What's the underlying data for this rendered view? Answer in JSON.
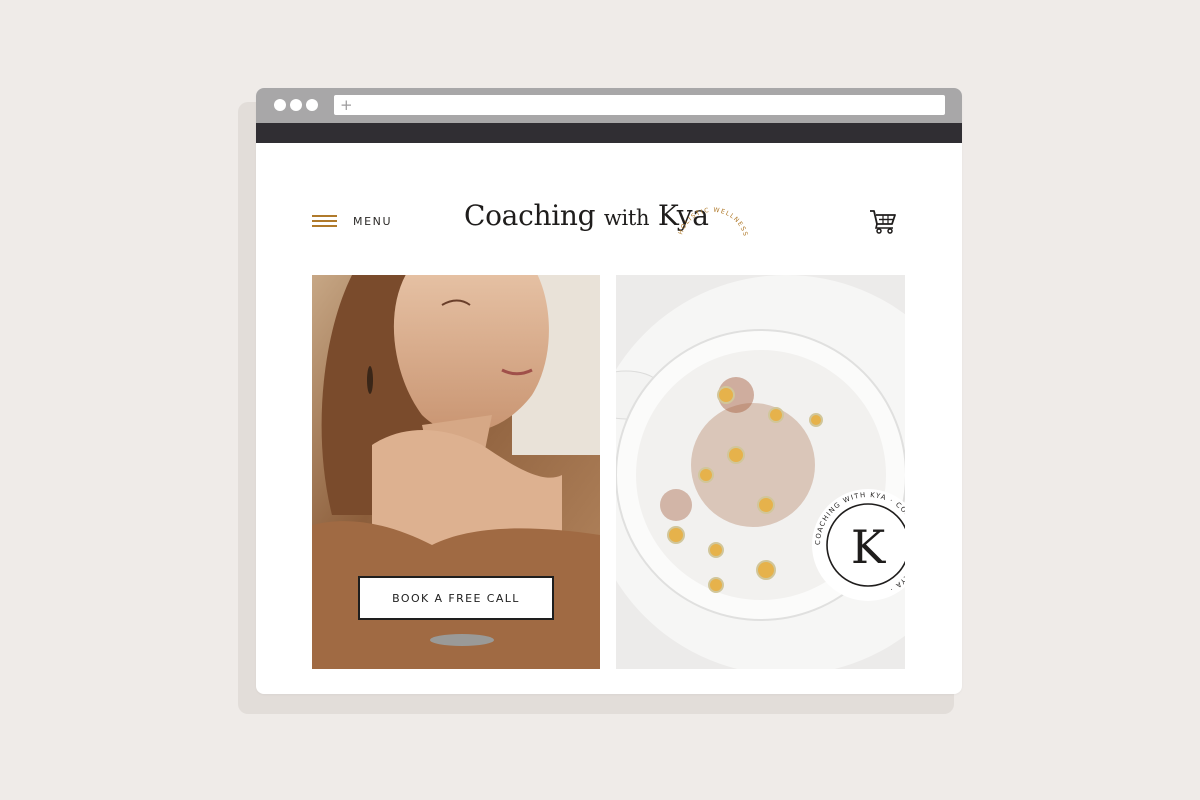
{
  "site": {
    "menu_label": "MENU",
    "logo_main": "Coaching",
    "logo_with": "with",
    "logo_name": "Kya",
    "logo_tagline": "HOLISTIC WELLNESS",
    "cta_label": "BOOK A FREE CALL",
    "badge_letter": "K",
    "badge_ring_text": "COACHING WITH KYA · COACHING WITH KYA ·"
  },
  "browser": {
    "new_tab_icon": "+"
  },
  "icons": {
    "menu": "hamburger-icon",
    "cart": "cart-icon",
    "new_tab": "plus-icon"
  },
  "colors": {
    "accent": "#b07a2b",
    "dark_bar": "#302e33",
    "background": "#efebe8"
  }
}
